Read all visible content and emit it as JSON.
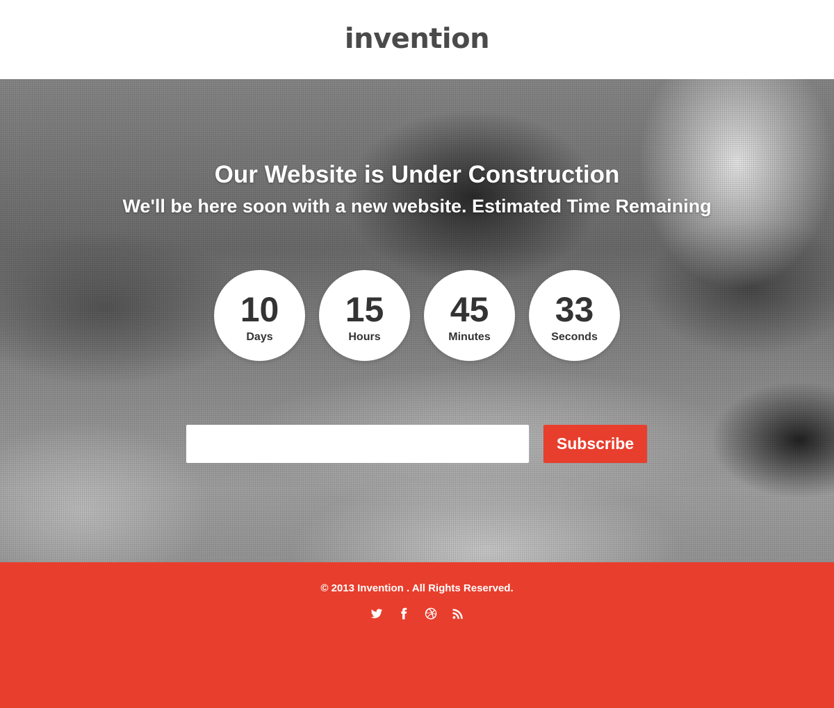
{
  "header": {
    "logo_text": "invention"
  },
  "hero": {
    "headline": "Our Website is Under Construction",
    "subheadline": "We'll be here soon with a new website. Estimated Time Remaining",
    "countdown": [
      {
        "value": "10",
        "label": "Days"
      },
      {
        "value": "15",
        "label": "Hours"
      },
      {
        "value": "45",
        "label": "Minutes"
      },
      {
        "value": "33",
        "label": "Seconds"
      }
    ],
    "subscribe": {
      "input_value": "",
      "input_placeholder": "",
      "button_label": "Subscribe"
    }
  },
  "footer": {
    "copyright": "© 2013 Invention . All Rights Reserved.",
    "social_icons": [
      "twitter-icon",
      "facebook-icon",
      "dribbble-icon",
      "rss-icon"
    ]
  },
  "colors": {
    "accent": "#e83e2d",
    "logo": "#4a4a4a",
    "counter_text": "#333333"
  }
}
